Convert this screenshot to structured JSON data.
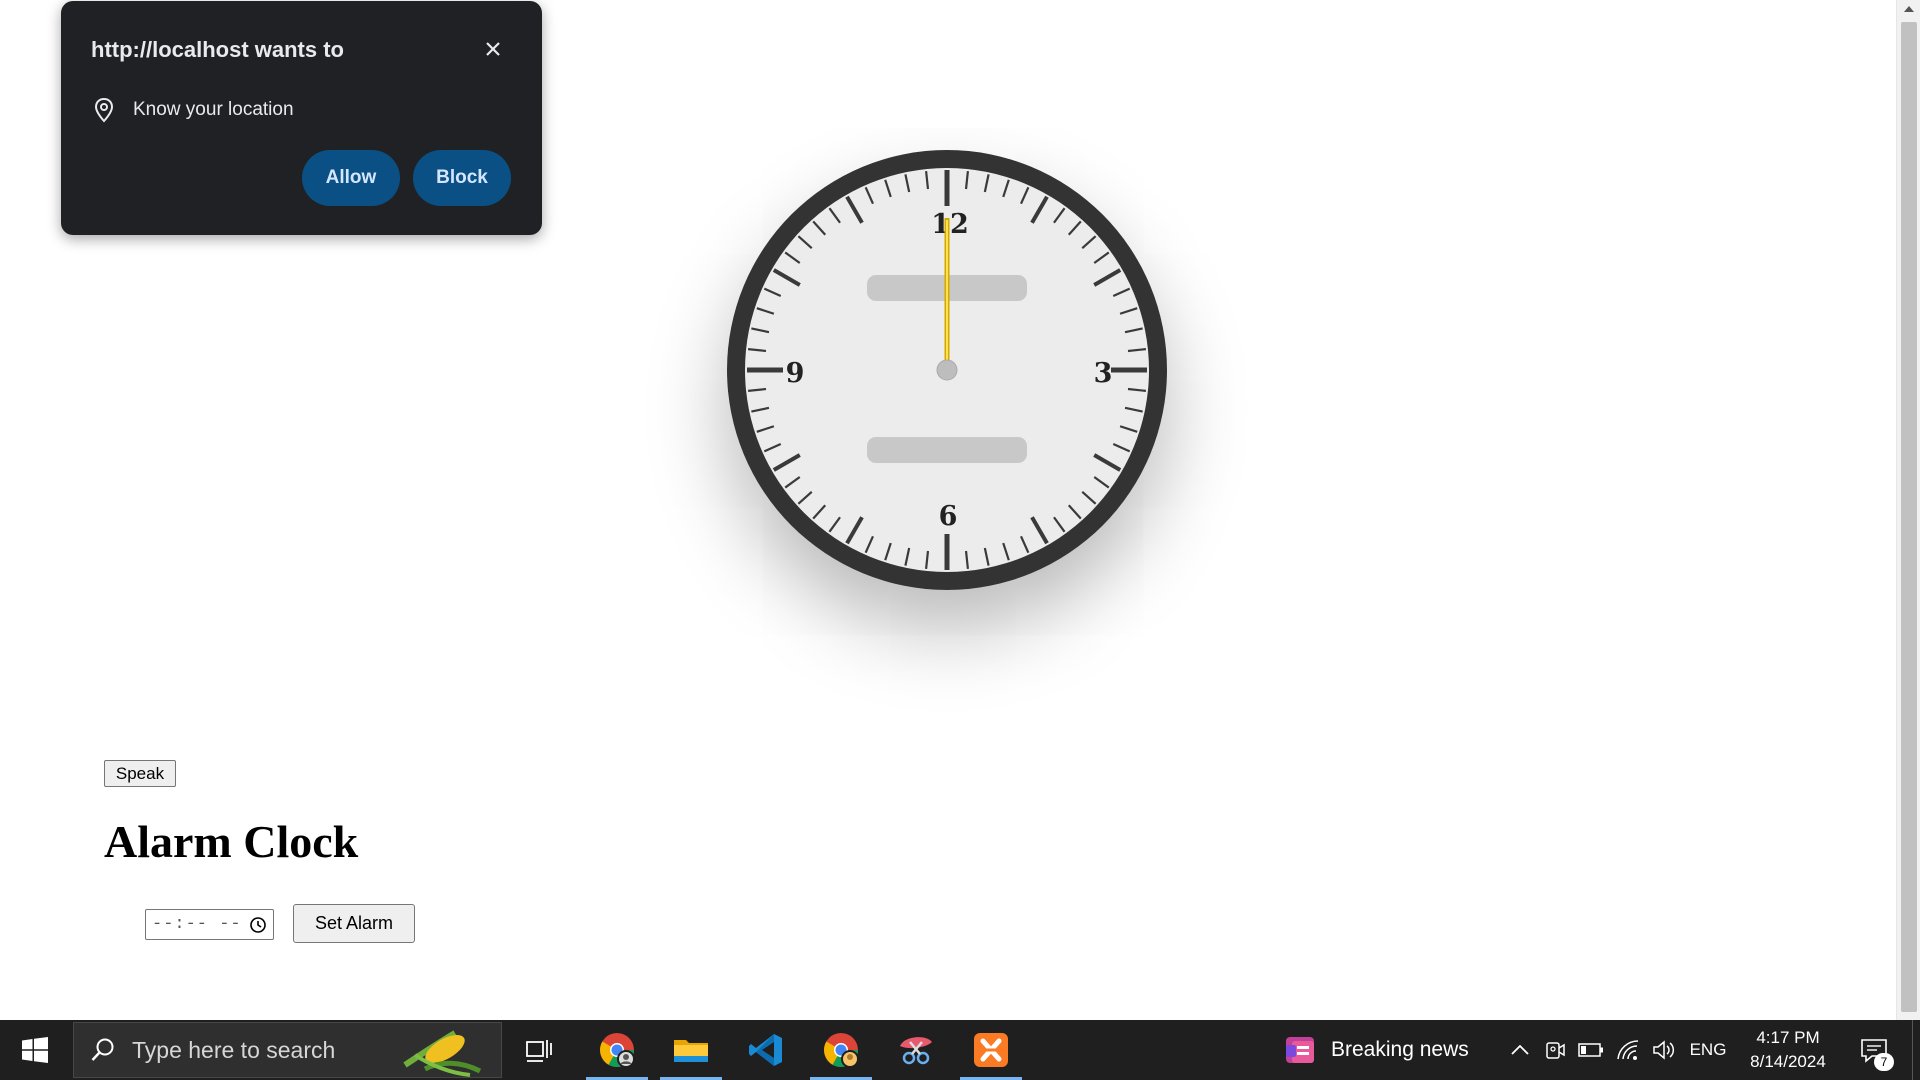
{
  "permission_popup": {
    "title": "http://localhost wants to",
    "request": "Know your location",
    "allow_label": "Allow",
    "block_label": "Block",
    "icons": {
      "close": "close-icon",
      "location": "location-pin-icon"
    }
  },
  "clock": {
    "numerals": [
      "12",
      "3",
      "6",
      "9"
    ],
    "colors": {
      "rim": "#333333",
      "face": "#ececec",
      "hand": "#f2c300",
      "pill": "#c8c8c8"
    }
  },
  "page": {
    "speak_label": "Speak",
    "heading": "Alarm Clock",
    "time_input_value": "--:-- --",
    "set_alarm_label": "Set Alarm"
  },
  "taskbar": {
    "search_placeholder": "Type here to search",
    "news_label": "Breaking news",
    "language": "ENG",
    "time": "4:17 PM",
    "date": "8/14/2024",
    "notification_count": "7",
    "apps": [
      "task-view",
      "chrome-profile",
      "file-explorer",
      "vscode",
      "chrome",
      "snipping-tool",
      "xampp"
    ]
  }
}
